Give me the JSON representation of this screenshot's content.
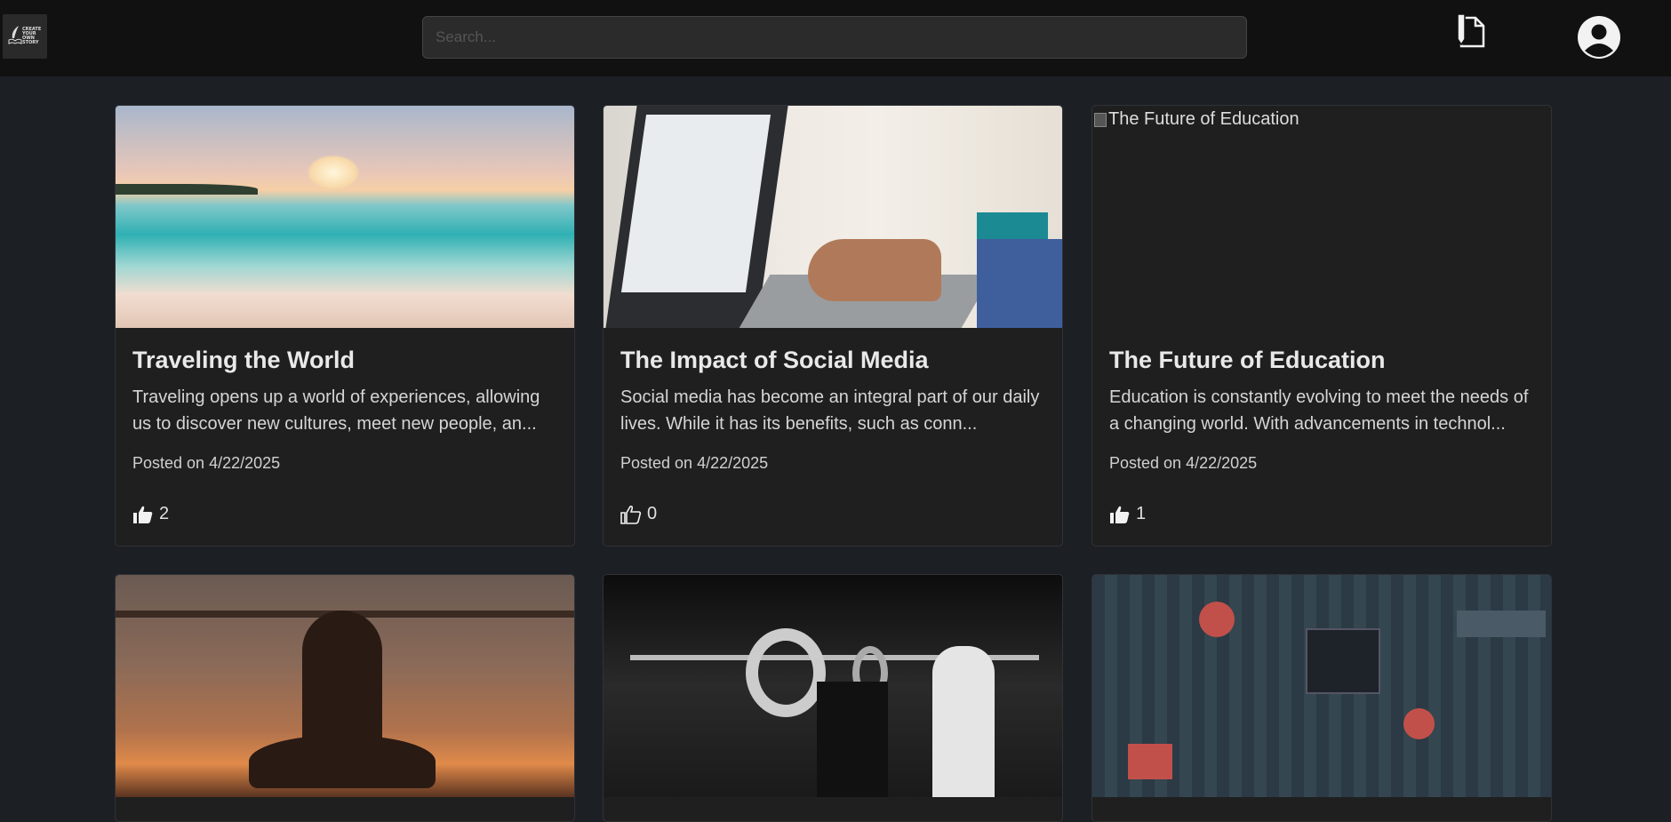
{
  "header": {
    "logo_text": "CREATE YOUR OWN STORY",
    "search_placeholder": "Search..."
  },
  "posts": [
    {
      "title": "Traveling the World",
      "excerpt": "Traveling opens up a world of experiences, allowing us to discover new cultures, meet new people, an...",
      "posted": "Posted on 4/22/2025",
      "likes": "2",
      "liked": true
    },
    {
      "title": "The Impact of Social Media",
      "excerpt": "Social media has become an integral part of our daily lives. While it has its benefits, such as conn...",
      "posted": "Posted on 4/22/2025",
      "likes": "0",
      "liked": false
    },
    {
      "title": "The Future of Education",
      "image_alt": "The Future of Education",
      "excerpt": "Education is constantly evolving to meet the needs of a changing world. With advancements in technol...",
      "posted": "Posted on 4/22/2025",
      "likes": "1",
      "liked": true
    }
  ],
  "colors": {
    "background": "#1c1f24",
    "topbar": "#111111",
    "card": "#1f1f1f"
  }
}
